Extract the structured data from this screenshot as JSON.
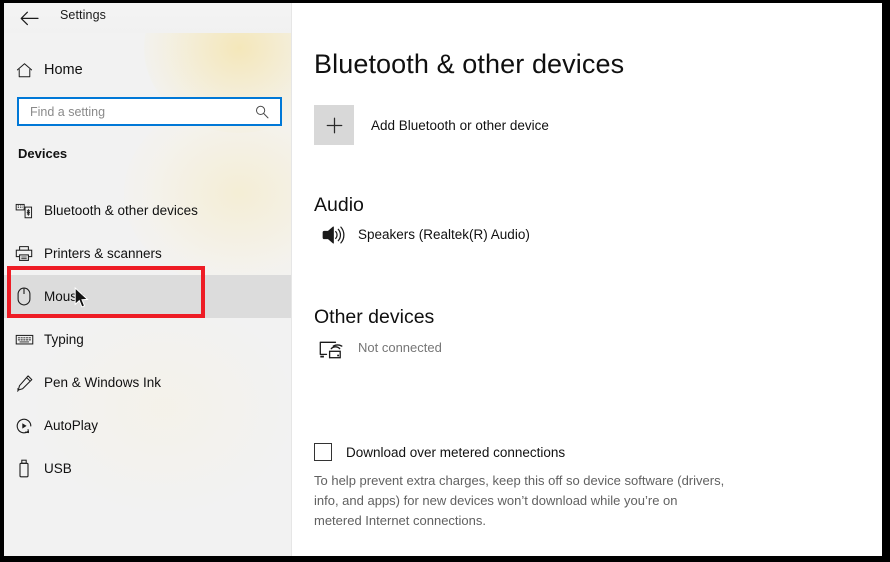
{
  "window": {
    "title": "Settings",
    "back_icon": "back-arrow-icon"
  },
  "sidebar": {
    "home": {
      "label": "Home",
      "icon": "home-icon"
    },
    "search": {
      "placeholder": "Find a setting",
      "value": "",
      "icon": "search-icon",
      "focus_color": "#0078d7"
    },
    "group_header": "Devices",
    "items": [
      {
        "label": "Bluetooth & other devices",
        "icon": "bluetooth-devices-icon",
        "selected": false
      },
      {
        "label": "Printers & scanners",
        "icon": "printer-icon",
        "selected": false
      },
      {
        "label": "Mouse",
        "icon": "mouse-icon",
        "selected": true
      },
      {
        "label": "Typing",
        "icon": "keyboard-icon",
        "selected": false
      },
      {
        "label": "Pen & Windows Ink",
        "icon": "pen-icon",
        "selected": false
      },
      {
        "label": "AutoPlay",
        "icon": "autoplay-icon",
        "selected": false
      },
      {
        "label": "USB",
        "icon": "usb-icon",
        "selected": false
      }
    ],
    "annotation": {
      "target": "Mouse",
      "color": "#ee1c25",
      "shape": "rectangle"
    }
  },
  "main": {
    "page_title": "Bluetooth & other devices",
    "add_device": {
      "label": "Add Bluetooth or other device",
      "icon": "plus-icon"
    },
    "sections": [
      {
        "title": "Audio",
        "devices": [
          {
            "name": "Speakers (Realtek(R) Audio)",
            "status": "",
            "icon": "speaker-icon",
            "redacted": false
          }
        ]
      },
      {
        "title": "Other devices",
        "devices": [
          {
            "name": "",
            "status": "Not connected",
            "icon": "wireless-display-icon",
            "redacted": true
          }
        ]
      }
    ],
    "metered": {
      "label": "Download over metered connections",
      "checked": false,
      "description": "To help prevent extra charges, keep this off so device software (drivers, info, and apps) for new devices won’t download while you’re on metered Internet connections."
    }
  }
}
